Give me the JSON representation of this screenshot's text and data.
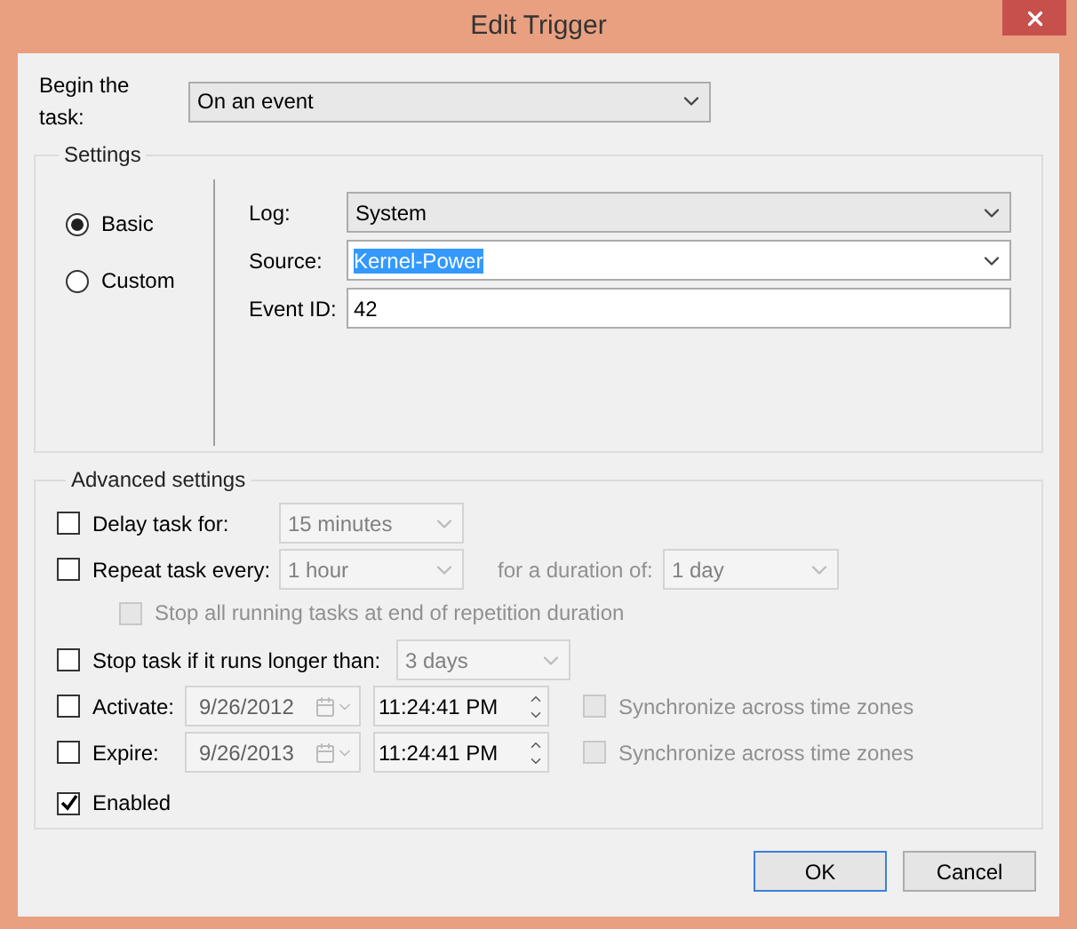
{
  "window": {
    "title": "Edit Trigger"
  },
  "begin_task": {
    "label": "Begin the task:",
    "value": "On an event"
  },
  "settings": {
    "title": "Settings",
    "modes": [
      {
        "label": "Basic",
        "selected": true
      },
      {
        "label": "Custom",
        "selected": false
      }
    ],
    "log": {
      "label": "Log:",
      "value": "System"
    },
    "source": {
      "label": "Source:",
      "value": "Kernel-Power",
      "highlighted": true
    },
    "event_id": {
      "label": "Event ID:",
      "value": "42"
    }
  },
  "advanced": {
    "title": "Advanced settings",
    "delay": {
      "label": "Delay task for:",
      "checked": false,
      "value": "15 minutes",
      "disabled": true
    },
    "repeat": {
      "label": "Repeat task every:",
      "checked": false,
      "value": "1 hour",
      "disabled": true,
      "duration_label": "for a duration of:",
      "duration_value": "1 day"
    },
    "stop_all": {
      "label": "Stop all running tasks at end of repetition duration",
      "checked": false,
      "disabled": true
    },
    "stop_if": {
      "label": "Stop task if it runs longer than:",
      "checked": false,
      "value": "3 days",
      "disabled": true
    },
    "dates": [
      {
        "label": "Activate:",
        "checked": false,
        "date": "9/26/2012",
        "time": "11:24:41 PM",
        "sync_label": "Synchronize across time zones",
        "sync_checked": false,
        "disabled": true
      },
      {
        "label": "Expire:",
        "checked": false,
        "date": "9/26/2013",
        "time": "11:24:41 PM",
        "sync_label": "Synchronize across time zones",
        "sync_checked": false,
        "disabled": true
      }
    ],
    "enabled": {
      "label": "Enabled",
      "checked": true
    }
  },
  "buttons": [
    {
      "label": "OK",
      "default": true
    },
    {
      "label": "Cancel",
      "default": false
    }
  ]
}
